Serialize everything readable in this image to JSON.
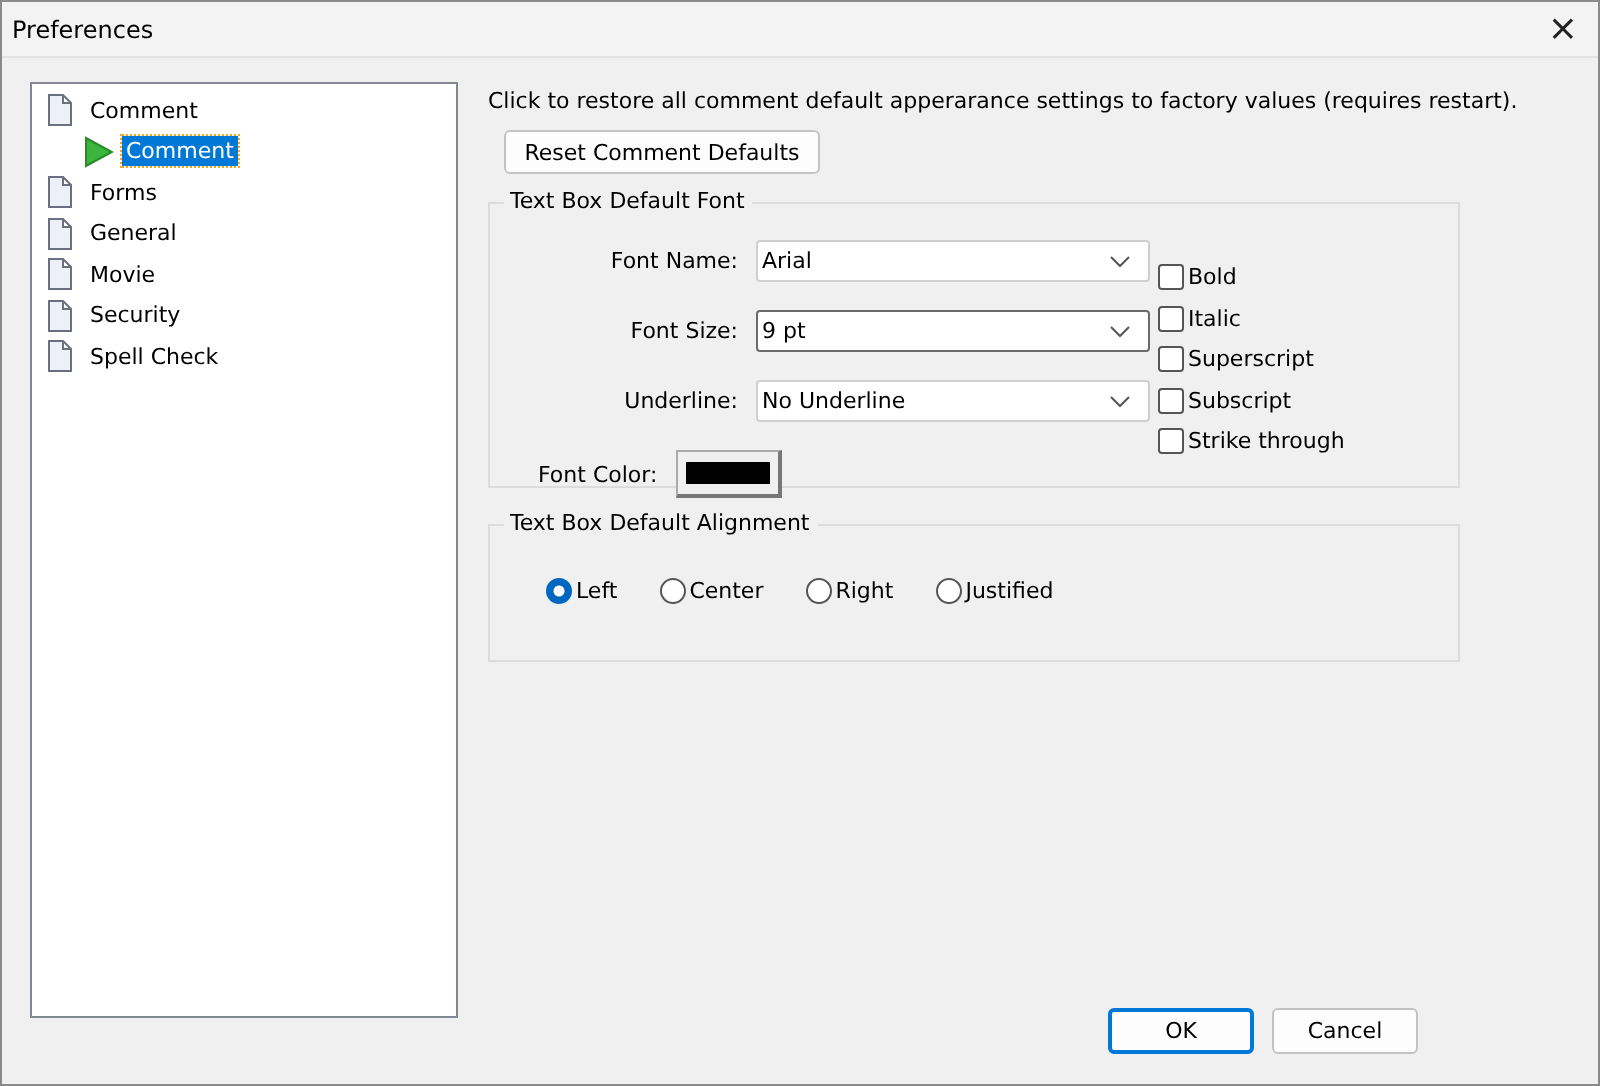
{
  "window": {
    "title": "Preferences",
    "close": "×"
  },
  "tree": [
    {
      "label": "Comment",
      "selected": false,
      "children": [
        {
          "label": "Comment",
          "selected": true
        }
      ]
    },
    {
      "label": "Forms",
      "selected": false
    },
    {
      "label": "General",
      "selected": false
    },
    {
      "label": "Movie",
      "selected": false
    },
    {
      "label": "Security",
      "selected": false
    },
    {
      "label": "Spell Check",
      "selected": false
    }
  ],
  "description": "Click to restore all comment default apperarance settings to factory values (requires restart).",
  "reset_button": "Reset Comment Defaults",
  "font_group": {
    "title": "Text Box Default Font",
    "fields": [
      {
        "label": "Font Name:",
        "value": "Arial",
        "focused": false
      },
      {
        "label": "Font Size:",
        "value": "9 pt",
        "focused": true
      },
      {
        "label": "Underline:",
        "value": "No Underline",
        "focused": false
      }
    ],
    "color": {
      "label": "Font Color:",
      "color": "#000000"
    },
    "checkboxes": [
      {
        "label": "Bold",
        "checked": false
      },
      {
        "label": "Italic",
        "checked": false
      },
      {
        "label": "Superscript",
        "checked": false
      },
      {
        "label": "Subscript",
        "checked": false
      },
      {
        "label": "Strike through",
        "checked": false
      }
    ]
  },
  "alignment_group": {
    "title": "Text Box Default Alignment",
    "options": [
      {
        "label": "Left",
        "selected": true
      },
      {
        "label": "Center",
        "selected": false
      },
      {
        "label": "Right",
        "selected": false
      },
      {
        "label": "Justified",
        "selected": false
      }
    ]
  },
  "buttons": [
    {
      "label": "OK",
      "default": true
    },
    {
      "label": "Cancel",
      "default": false
    }
  ]
}
